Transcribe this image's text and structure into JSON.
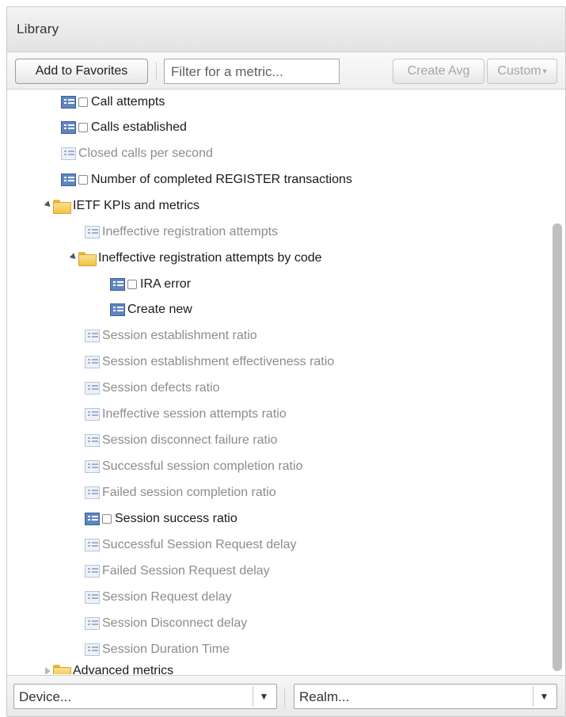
{
  "panel": {
    "title": "Library"
  },
  "toolbar": {
    "add_favorites_label": "Add to Favorites",
    "filter_placeholder": "Filter for a metric...",
    "create_avg_label": "Create Avg",
    "custom_label": "Custom"
  },
  "tree": {
    "rows": [
      {
        "label": "Call attempts"
      },
      {
        "label": "Calls established"
      },
      {
        "label": "Closed calls per second"
      },
      {
        "label": "Number of completed REGISTER transactions"
      },
      {
        "label": "IETF KPIs and metrics"
      },
      {
        "label": "Ineffective registration attempts"
      },
      {
        "label": "Ineffective registration attempts by code"
      },
      {
        "label": "IRA error"
      },
      {
        "label": "Create new"
      },
      {
        "label": "Session establishment ratio"
      },
      {
        "label": "Session establishment effectiveness ratio"
      },
      {
        "label": "Session defects ratio"
      },
      {
        "label": "Ineffective session attempts ratio"
      },
      {
        "label": "Session disconnect failure ratio"
      },
      {
        "label": "Successful session completion ratio"
      },
      {
        "label": "Failed session completion ratio"
      },
      {
        "label": "Session success ratio"
      },
      {
        "label": "Successful Session Request delay"
      },
      {
        "label": "Failed Session Request delay"
      },
      {
        "label": "Session Request delay"
      },
      {
        "label": "Session Disconnect delay"
      },
      {
        "label": "Session Duration Time"
      },
      {
        "label": "Advanced metrics"
      }
    ]
  },
  "footer": {
    "device_label": "Device...",
    "realm_label": "Realm..."
  },
  "icons": {
    "metric": "metric-table-icon",
    "folder": "folder-icon",
    "expand_open": "triangle-down-icon",
    "expand_closed": "triangle-right-icon",
    "dropdown": "chevron-down-icon"
  },
  "colors": {
    "active_text": "#1a1a1a",
    "inactive_text": "#8c8c8c",
    "metric_active": "#5f86c2",
    "folder": "#f1c24a"
  }
}
